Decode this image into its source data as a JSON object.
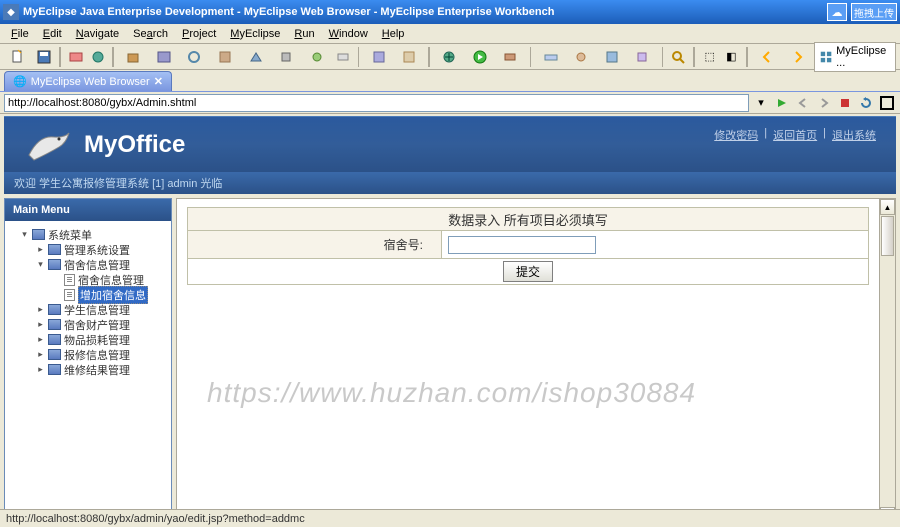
{
  "window": {
    "title": "MyEclipse Java Enterprise Development - MyEclipse Web Browser - MyEclipse Enterprise Workbench",
    "upload_btn": "拖拽上传"
  },
  "menu": {
    "file": "File",
    "edit": "Edit",
    "navigate": "Navigate",
    "search": "Search",
    "project": "Project",
    "myeclipse": "MyEclipse",
    "run": "Run",
    "window": "Window",
    "help": "Help"
  },
  "perspective": {
    "label": "MyEclipse ..."
  },
  "editor_tab": {
    "title": "MyEclipse Web Browser"
  },
  "url": {
    "value": "http://localhost:8080/gybx/Admin.shtml"
  },
  "header": {
    "logo": "MyOffice",
    "links": {
      "pwd": "修改密码",
      "home": "返回首页",
      "logout": "退出系统"
    }
  },
  "welcome": "欢迎 学生公寓报修管理系统 [1] admin 光临",
  "sidebar": {
    "title": "Main Menu",
    "nodes": [
      {
        "label": "系统菜单",
        "level": 1,
        "icon": "folder",
        "exp": "▾"
      },
      {
        "label": "管理系统设置",
        "level": 2,
        "icon": "folder",
        "exp": "▸"
      },
      {
        "label": "宿舍信息管理",
        "level": 2,
        "icon": "folder",
        "exp": "▾"
      },
      {
        "label": "宿舍信息管理",
        "level": 3,
        "icon": "page",
        "exp": ""
      },
      {
        "label": "增加宿舍信息",
        "level": 3,
        "icon": "page",
        "exp": "",
        "selected": true
      },
      {
        "label": "学生信息管理",
        "level": 2,
        "icon": "folder",
        "exp": "▸"
      },
      {
        "label": "宿舍财产管理",
        "level": 2,
        "icon": "folder",
        "exp": "▸"
      },
      {
        "label": "物品损耗管理",
        "level": 2,
        "icon": "folder",
        "exp": "▸"
      },
      {
        "label": "报修信息管理",
        "level": 2,
        "icon": "folder",
        "exp": "▸"
      },
      {
        "label": "维修结果管理",
        "level": 2,
        "icon": "folder",
        "exp": "▸"
      }
    ]
  },
  "form": {
    "header": "数据录入 所有项目必须填写",
    "dorm_label": "宿舍号:",
    "dorm_value": "",
    "submit": "提交"
  },
  "watermark": "https://www.huzhan.com/ishop30884",
  "statusbar": "http://localhost:8080/gybx/admin/yao/edit.jsp?method=addmc"
}
